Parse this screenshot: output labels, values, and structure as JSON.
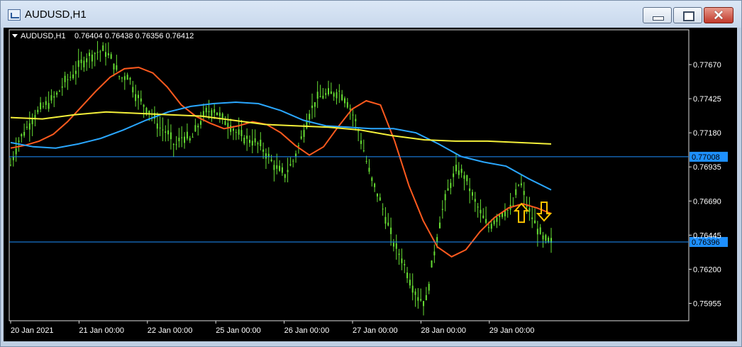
{
  "window": {
    "title": "AUDUSD,H1"
  },
  "chart_info": {
    "symbol_label": "AUDUSD,H1",
    "ohlc": "0.76404 0.76438 0.76356 0.76412"
  },
  "chart_data": {
    "type": "line",
    "symbol": "AUDUSD",
    "timeframe": "H1",
    "ylim": [
      0.7583,
      0.7792
    ],
    "y_ticks": [
      "0.77670",
      "0.77425",
      "0.77180",
      "0.76935",
      "0.76690",
      "0.76445",
      "0.76200",
      "0.75955"
    ],
    "x_ticks": [
      "20 Jan 2021",
      "21 Jan 00:00",
      "22 Jan 00:00",
      "25 Jan 00:00",
      "26 Jan 00:00",
      "27 Jan 00:00",
      "28 Jan 00:00",
      "29 Jan 00:00"
    ],
    "price_levels": [
      {
        "value": 0.77008,
        "label": "0.77008"
      },
      {
        "value": 0.76396,
        "label": "0.76396"
      }
    ],
    "colors": {
      "candles": "#66dd33",
      "ma_fast": "#ff5a1e",
      "ma_mid": "#2aa7ff",
      "ma_slow": "#f4f03a",
      "level": "#1e90ff",
      "arrows": "#ffc400"
    },
    "series": [
      {
        "color": "#66dd33",
        "values": [
          0.7695,
          0.7712,
          0.7721,
          0.773,
          0.7736,
          0.774,
          0.7746,
          0.7755,
          0.776,
          0.7768,
          0.7773,
          0.7776,
          0.7777,
          0.777,
          0.7757,
          0.776,
          0.7745,
          0.7738,
          0.7732,
          0.7722,
          0.7718,
          0.7708,
          0.7716,
          0.7712,
          0.7724,
          0.7733,
          0.7735,
          0.7728,
          0.7724,
          0.7717,
          0.7714,
          0.7712,
          0.7708,
          0.77,
          0.7692,
          0.7688,
          0.7697,
          0.7712,
          0.773,
          0.7742,
          0.7745,
          0.7746,
          0.7748,
          0.774,
          0.7727,
          0.7707,
          0.7685,
          0.7672,
          0.7655,
          0.7637,
          0.7627,
          0.7612,
          0.76,
          0.7596,
          0.763,
          0.766,
          0.768,
          0.7692,
          0.7687,
          0.7672,
          0.766,
          0.765,
          0.7657,
          0.7662,
          0.7663,
          0.7684,
          0.7664,
          0.7652,
          0.7641,
          0.7639
        ]
      },
      {
        "color": "#ff5a1e",
        "values": [
          0.7707,
          0.7709,
          0.7712,
          0.7717,
          0.7726,
          0.7737,
          0.7748,
          0.7758,
          0.7764,
          0.7765,
          0.7761,
          0.7751,
          0.7738,
          0.773,
          0.7725,
          0.7721,
          0.7723,
          0.7726,
          0.7724,
          0.7718,
          0.7709,
          0.7702,
          0.7708,
          0.7722,
          0.7735,
          0.7741,
          0.7738,
          0.7712,
          0.768,
          0.7655,
          0.7636,
          0.7629,
          0.7634,
          0.7647,
          0.7657,
          0.7664,
          0.7667,
          0.7664,
          0.766
        ]
      },
      {
        "color": "#2aa7ff",
        "values": [
          0.7711,
          0.7708,
          0.7707,
          0.771,
          0.7714,
          0.772,
          0.7727,
          0.7733,
          0.7737,
          0.7739,
          0.774,
          0.7739,
          0.7734,
          0.7727,
          0.7723,
          0.7722,
          0.7721,
          0.7721,
          0.7718,
          0.771,
          0.7701,
          0.7697,
          0.7694,
          0.7685,
          0.7677
        ]
      },
      {
        "color": "#f4f03a",
        "values": [
          0.7729,
          0.7728,
          0.7731,
          0.7733,
          0.7732,
          0.7731,
          0.773,
          0.7727,
          0.7724,
          0.7723,
          0.7722,
          0.772,
          0.7716,
          0.7713,
          0.7712,
          0.7712,
          0.7711,
          0.771
        ]
      }
    ],
    "annotations": {
      "arrow_up_price": 0.7664,
      "arrow_down_price": 0.766
    },
    "grid": false
  }
}
